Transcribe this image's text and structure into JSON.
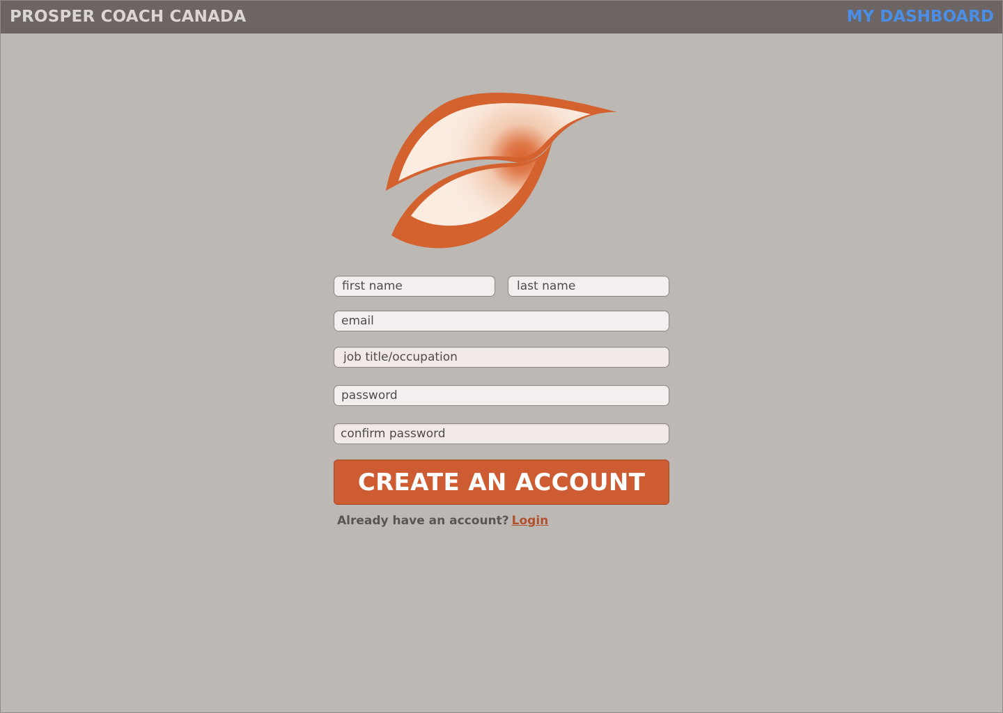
{
  "header": {
    "brand": "PROSPER COACH CANADA",
    "dashboard_link": "MY DASHBOARD"
  },
  "logo": {
    "icon": "leaf-logo-icon",
    "color": "#d4622e"
  },
  "form": {
    "first_name_placeholder": "first name",
    "last_name_placeholder": "last name",
    "email_placeholder": "email",
    "job_placeholder": "job title/occupation",
    "password_placeholder": "password",
    "confirm_password_placeholder": "confirm password",
    "submit_label": "CREATE AN ACCOUNT",
    "already_text": "Already have an account?",
    "login_label": "Login"
  },
  "colors": {
    "background": "#bcb9b5",
    "topbar": "#6d6564",
    "accent": "#cd5c32",
    "link": "#4a8ee6"
  }
}
